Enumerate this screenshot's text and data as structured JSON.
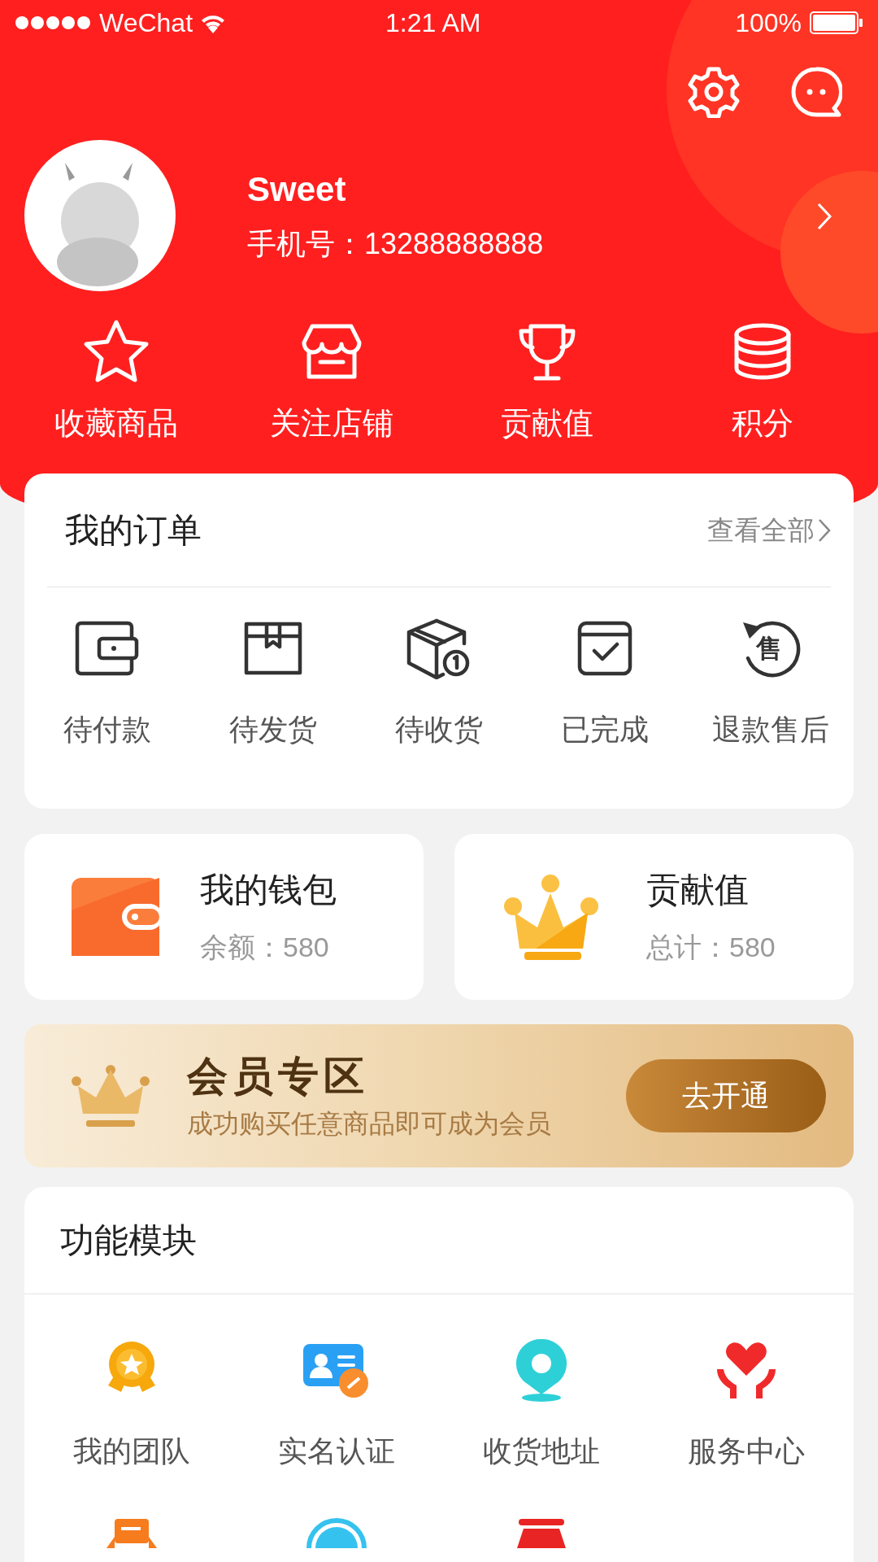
{
  "status_bar": {
    "carrier": "WeChat",
    "time": "1:21 AM",
    "battery": "100%"
  },
  "profile": {
    "name": "Sweet",
    "phone": "手机号：13288888888"
  },
  "quick_links": [
    {
      "label": "收藏商品"
    },
    {
      "label": "关注店铺"
    },
    {
      "label": "贡献值"
    },
    {
      "label": "积分"
    }
  ],
  "orders": {
    "title": "我的订单",
    "view_all": "查看全部",
    "items": [
      {
        "label": "待付款"
      },
      {
        "label": "待发货"
      },
      {
        "label": "待收货"
      },
      {
        "label": "已完成"
      },
      {
        "label": "退款售后",
        "icon_text": "售"
      }
    ]
  },
  "summary_cards": [
    {
      "title": "我的钱包",
      "detail": "余额：580"
    },
    {
      "title": "贡献值",
      "detail": "总计：580"
    }
  ],
  "membership": {
    "title": "会员专区",
    "subtitle": "成功购买任意商品即可成为会员",
    "button": "去开通"
  },
  "modules": {
    "title": "功能模块",
    "items": [
      {
        "label": "我的团队"
      },
      {
        "label": "实名认证"
      },
      {
        "label": "收货地址"
      },
      {
        "label": "服务中心"
      }
    ]
  }
}
